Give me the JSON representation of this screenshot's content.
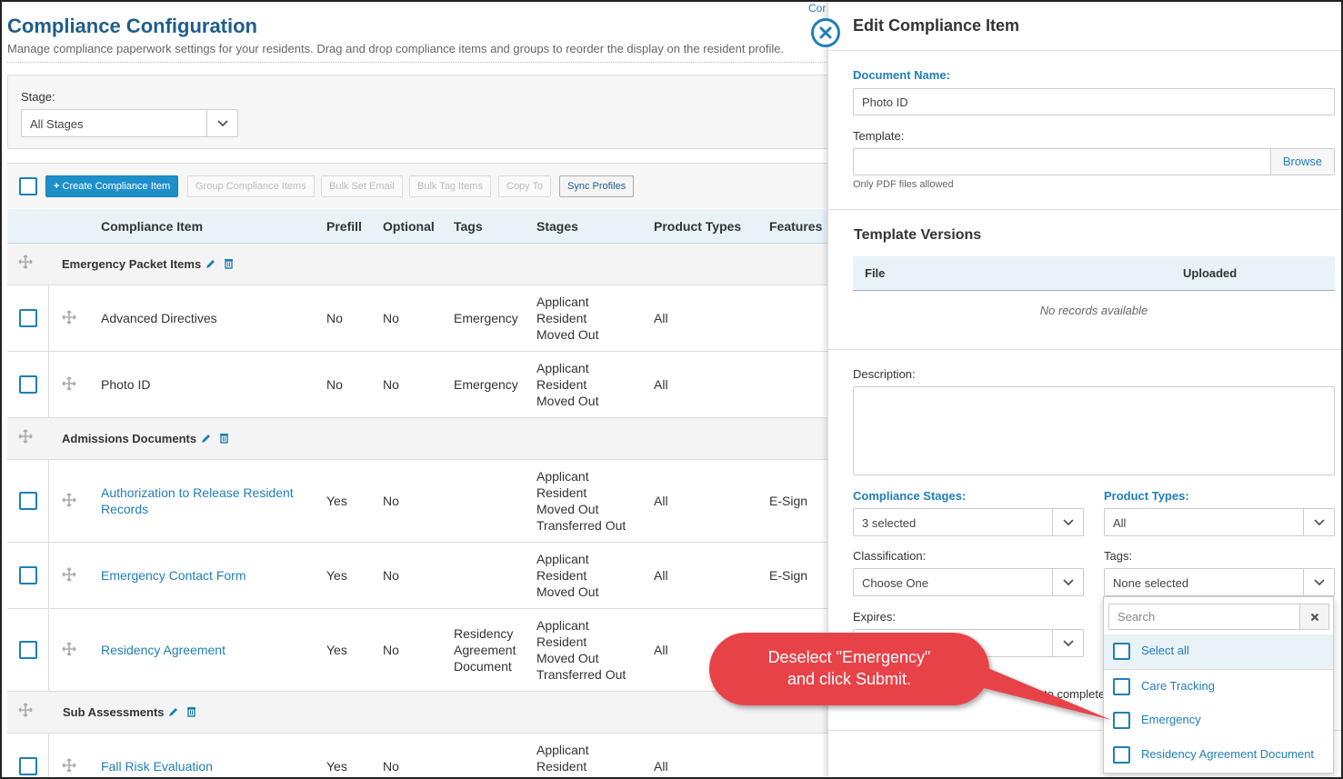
{
  "page": {
    "title": "Compliance Configuration",
    "subtitle": "Manage compliance paperwork settings for your residents. Drag and drop compliance items and groups to reorder the display on the resident profile."
  },
  "stage_filter": {
    "label": "Stage:",
    "value": "All Stages"
  },
  "toolbar": {
    "create": "Create Compliance Item",
    "group": "Group Compliance Items",
    "bulk_email": "Bulk Set Email",
    "bulk_tag": "Bulk Tag Items",
    "copy_to": "Copy To",
    "sync": "Sync Profiles",
    "plus": "+"
  },
  "table": {
    "headers": [
      "Compliance Item",
      "Prefill",
      "Optional",
      "Tags",
      "Stages",
      "Product Types",
      "Features"
    ],
    "groups": [
      {
        "name": "Emergency Packet Items"
      },
      {
        "name": "Admissions Documents"
      },
      {
        "name": "Sub Assessments"
      }
    ],
    "rows": [
      {
        "name": "Advanced Directives",
        "prefill": "No",
        "optional": "No",
        "tags": "Emergency",
        "stages": "Applicant\nResident\nMoved Out",
        "product": "All",
        "features": ""
      },
      {
        "name": "Photo ID",
        "prefill": "No",
        "optional": "No",
        "tags": "Emergency",
        "stages": "Applicant\nResident\nMoved Out",
        "product": "All",
        "features": ""
      },
      {
        "name": "Authorization to Release Resident\nRecords",
        "prefill": "Yes",
        "optional": "No",
        "tags": "",
        "stages": "Applicant\nResident\nMoved Out\nTransferred Out",
        "product": "All",
        "features": "E-Sign"
      },
      {
        "name": "Emergency Contact Form",
        "prefill": "Yes",
        "optional": "No",
        "tags": "",
        "stages": "Applicant\nResident\nMoved Out",
        "product": "All",
        "features": "E-Sign"
      },
      {
        "name": "Residency Agreement",
        "prefill": "Yes",
        "optional": "No",
        "tags": "Residency\nAgreement\nDocument",
        "stages": "Applicant\nResident\nMoved Out\nTransferred Out",
        "product": "All",
        "features": ""
      },
      {
        "name": "Fall Risk Evaluation",
        "prefill": "Yes",
        "optional": "No",
        "tags": "",
        "stages": "Applicant\nResident",
        "product": "All",
        "features": ""
      }
    ]
  },
  "drawer": {
    "peek_text": "Cor",
    "title": "Edit Compliance Item",
    "document_name_label": "Document Name:",
    "document_name_value": "Photo ID",
    "template_label": "Template:",
    "browse": "Browse",
    "template_hint": "Only PDF files allowed",
    "template_versions_title": "Template Versions",
    "tv_file": "File",
    "tv_uploaded": "Uploaded",
    "tv_empty": "No records available",
    "description_label": "Description:",
    "stages_label": "Compliance Stages:",
    "stages_value": "3 selected",
    "product_label": "Product Types:",
    "product_value": "All",
    "classification_label": "Classification:",
    "classification_value": "Choose One",
    "tags_label": "Tags:",
    "tags_value": "None selected",
    "expires_label": "Expires:",
    "partial_text": "to complete"
  },
  "tags_dropdown": {
    "search_placeholder": "Search",
    "options": [
      "Select all",
      "Care Tracking",
      "Emergency",
      "Residency Agreement Document"
    ]
  },
  "callout": {
    "line1": "Deselect \"Emergency\"",
    "line2": "and click Submit.",
    "color": "#e8424a"
  },
  "colors": {
    "brand": "#1f5d8c",
    "accent": "#1e7fb8",
    "header_bg": "#e8f2f7"
  }
}
